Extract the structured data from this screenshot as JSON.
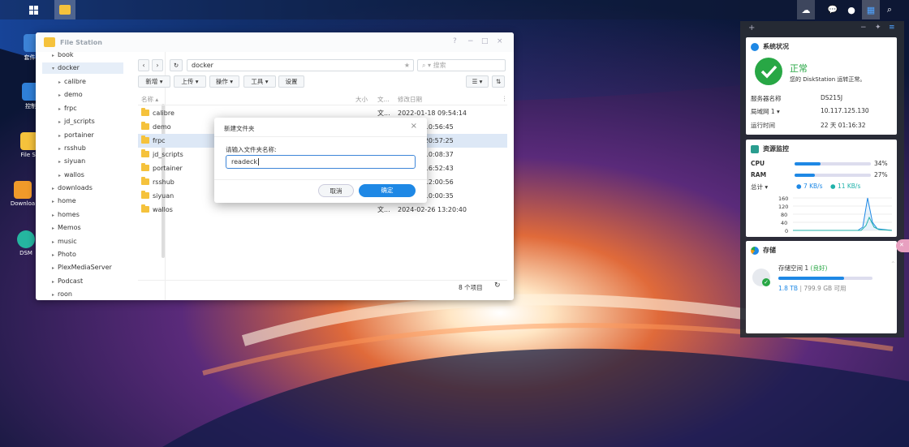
{
  "desktop": {
    "icons": [
      {
        "label": "套件中"
      },
      {
        "label": "控制"
      },
      {
        "label": "File St"
      },
      {
        "label": "Downloa"
      },
      {
        "label": "DSM"
      }
    ]
  },
  "file_station": {
    "title": "File Station",
    "window_controls": [
      "?",
      "−",
      "□",
      "×"
    ],
    "tree": [
      "book",
      "docker",
      "calibre",
      "demo",
      "frpc",
      "jd_scripts",
      "portainer",
      "rsshub",
      "siyuan",
      "wallos",
      "downloads",
      "home",
      "homes",
      "Memos",
      "music",
      "Photo",
      "PlexMediaServer",
      "Podcast",
      "roon"
    ],
    "path": "docker",
    "search_placeholder": "搜索",
    "toolbar": {
      "new": "新增",
      "upload": "上传",
      "action": "操作",
      "tools": "工具",
      "settings": "设置"
    },
    "columns": {
      "name": "名称",
      "size": "大小",
      "type": "文...",
      "modified": "修改日期"
    },
    "rows": [
      {
        "name": "calibre",
        "type": "文...",
        "modified": "2022-01-18 09:54:14"
      },
      {
        "name": "demo",
        "type": "文...",
        "modified": "17 10:56:45"
      },
      {
        "name": "frpc",
        "type": "",
        "modified": "10 20:57:25"
      },
      {
        "name": "jd_scripts",
        "type": "",
        "modified": "10 10:08:37"
      },
      {
        "name": "portainer",
        "type": "",
        "modified": "14 16:52:43"
      },
      {
        "name": "rsshub",
        "type": "",
        "modified": "01 12:00:56"
      },
      {
        "name": "siyuan",
        "type": "",
        "modified": "22 10:00:35"
      },
      {
        "name": "wallos",
        "type": "文...",
        "modified": "2024-02-26 13:20:40"
      }
    ],
    "item_count": "8 个项目"
  },
  "dialog": {
    "title": "新建文件夹",
    "label": "请输入文件夹名称:",
    "value": "readeck",
    "cancel": "取消",
    "ok": "确定"
  },
  "widgets": {
    "status": {
      "title": "系统状况",
      "state": "正常",
      "message": "您的 DiskStation 运转正常。",
      "rows": [
        {
          "k": "服务器名称",
          "v": "DS215J"
        },
        {
          "k": "局域网 1",
          "v": "10.117.125.130"
        },
        {
          "k": "运行时间",
          "v": "22 天 01:16:32"
        }
      ]
    },
    "resource": {
      "title": "资源监控",
      "cpu_label": "CPU",
      "cpu_value": "34%",
      "cpu": 0.34,
      "ram_label": "RAM",
      "ram_value": "27%",
      "ram": 0.27,
      "total_label": "总计",
      "up": "7 KB/s",
      "down": "11 KB/s",
      "yticks": [
        "160",
        "120",
        "80",
        "40",
        "0"
      ]
    },
    "storage": {
      "title": "存储",
      "volume": "存储空间 1",
      "volume_state": "(良好)",
      "used": "1.8 TB",
      "available": "799.9 GB 可用",
      "usage": 0.7
    }
  },
  "colors": {
    "accent": "#1e88e5",
    "ok_green": "#28a745",
    "folder": "#f5c23c"
  }
}
